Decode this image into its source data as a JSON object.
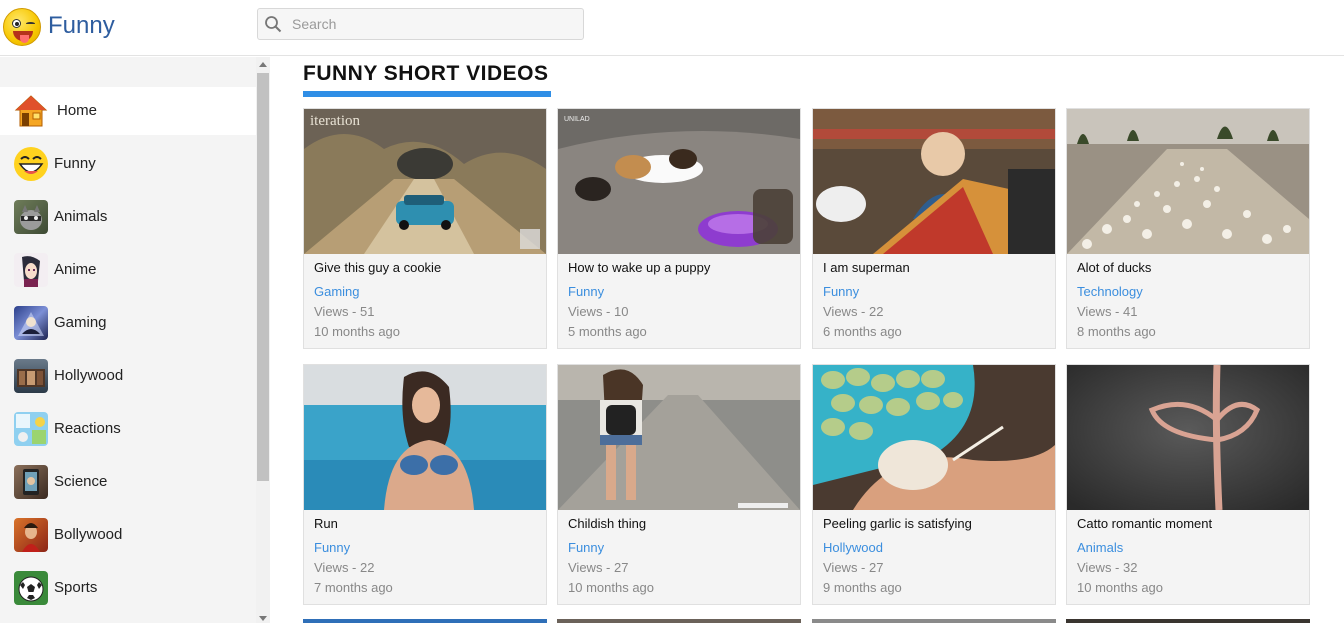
{
  "header": {
    "brand": "Funny",
    "search_placeholder": "Search"
  },
  "sidebar": {
    "items": [
      {
        "label": "Home",
        "icon": "home-icon"
      },
      {
        "label": "Funny",
        "icon": "laughing-face-icon"
      },
      {
        "label": "Animals",
        "icon": "raccoon-icon"
      },
      {
        "label": "Anime",
        "icon": "anime-icon"
      },
      {
        "label": "Gaming",
        "icon": "gaming-icon"
      },
      {
        "label": "Hollywood",
        "icon": "hollywood-icon"
      },
      {
        "label": "Reactions",
        "icon": "reactions-icon"
      },
      {
        "label": "Science",
        "icon": "science-icon"
      },
      {
        "label": "Bollywood",
        "icon": "bollywood-icon"
      },
      {
        "label": "Sports",
        "icon": "soccer-ball-icon"
      }
    ]
  },
  "main": {
    "section_title": "FUNNY SHORT VIDEOS",
    "videos": [
      {
        "title": "Give this guy a cookie",
        "category": "Gaming",
        "views": "Views - 51",
        "age": "10 months ago"
      },
      {
        "title": "How to wake up a puppy",
        "category": "Funny",
        "views": "Views - 10",
        "age": "5 months ago"
      },
      {
        "title": "I am superman",
        "category": "Funny",
        "views": "Views - 22",
        "age": "6 months ago"
      },
      {
        "title": "Alot of ducks",
        "category": "Technology",
        "views": "Views - 41",
        "age": "8 months ago"
      },
      {
        "title": "Run",
        "category": "Funny",
        "views": "Views - 22",
        "age": "7 months ago"
      },
      {
        "title": "Childish thing",
        "category": "Funny",
        "views": "Views - 27",
        "age": "10 months ago"
      },
      {
        "title": "Peeling garlic is satisfying",
        "category": "Hollywood",
        "views": "Views - 27",
        "age": "9 months ago"
      },
      {
        "title": "Catto romantic moment",
        "category": "Animals",
        "views": "Views - 32",
        "age": "10 months ago"
      }
    ]
  },
  "colors": {
    "accent": "#2f8ee6",
    "category_link": "#3b8ede",
    "brand": "#2e5d9f"
  }
}
